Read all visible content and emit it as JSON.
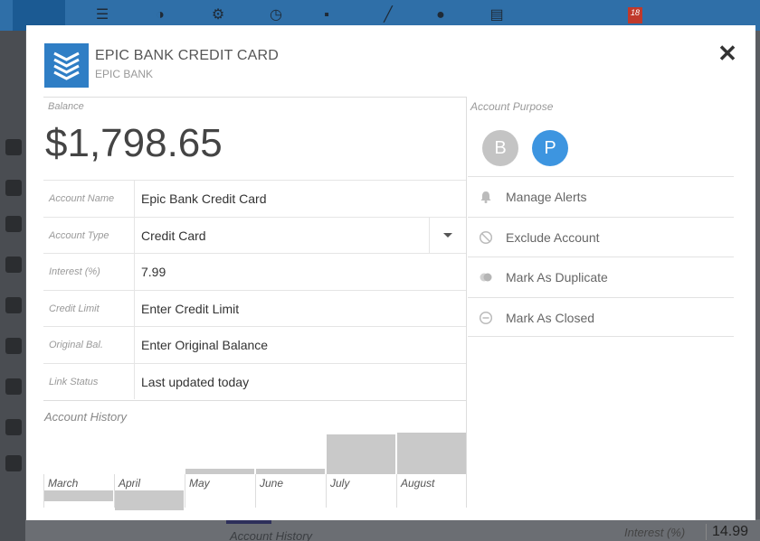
{
  "background": {
    "calendar_day": "18",
    "account_history_label": "Account History",
    "interest_label": "Interest (%)",
    "interest_value": "14.99"
  },
  "modal": {
    "title": "EPIC BANK CREDIT CARD",
    "subtitle": "EPIC BANK",
    "close_label": "✕",
    "balance_label": "Balance",
    "balance_value": "$1,798.65",
    "fields": [
      {
        "label": "Account Name",
        "value": "Epic Bank Credit Card"
      },
      {
        "label": "Account Type",
        "value": "Credit Card"
      },
      {
        "label": "Interest (%)",
        "value": "7.99"
      },
      {
        "label": "Credit Limit",
        "value": "Enter Credit Limit"
      },
      {
        "label": "Original Bal.",
        "value": "Enter Original Balance"
      },
      {
        "label": "Link Status",
        "value": "Last updated today"
      }
    ],
    "account_history_title": "Account History",
    "history_months": [
      "March",
      "April",
      "May",
      "June",
      "July",
      "August"
    ],
    "history_levels": [
      -0.15,
      -0.28,
      0.08,
      0.08,
      0.55,
      0.57
    ],
    "account_purpose_label": "Account Purpose",
    "purpose_options": [
      {
        "letter": "B",
        "color": "#c4c4c4",
        "selected": false
      },
      {
        "letter": "P",
        "color": "#3d95e0",
        "selected": true
      }
    ],
    "actions": [
      {
        "label": "Manage Alerts",
        "icon": "bell-icon"
      },
      {
        "label": "Exclude Account",
        "icon": "prohibited-icon"
      },
      {
        "label": "Mark As Duplicate",
        "icon": "duplicate-icon"
      },
      {
        "label": "Mark As Closed",
        "icon": "minus-circle-icon"
      }
    ]
  }
}
